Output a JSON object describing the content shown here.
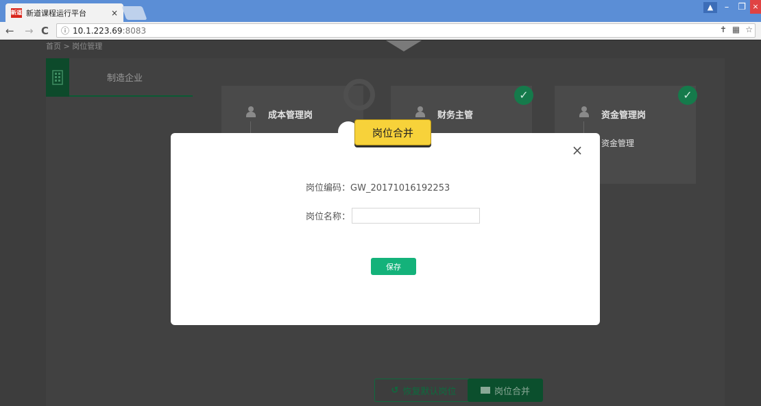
{
  "browser": {
    "tab_title": "新道课程运行平台",
    "tab_close": "×",
    "favicon_text": "新道",
    "url_host": "10.1.223.69",
    "url_port": ":8083"
  },
  "page": {
    "breadcrumb": "首页 > 岗位管理",
    "left_menu": {
      "label": "制造企业"
    },
    "cards": [
      {
        "title": "成本管理岗",
        "sub": ""
      },
      {
        "title": "财务主管",
        "sub": ""
      },
      {
        "title": "资金管理岗",
        "sub": "资金管理"
      }
    ],
    "buttons": {
      "restore": "恢复默认岗位",
      "merge": "岗位合并"
    }
  },
  "modal": {
    "title": "岗位合并",
    "code_label": "岗位编码：",
    "code_value": "GW_20171016192253",
    "name_label": "岗位名称：",
    "name_value": "",
    "save": "保存",
    "close": "×"
  },
  "colors": {
    "save_button": "#14b27a",
    "badge": "#f7d23a",
    "check": "#157a4b"
  }
}
